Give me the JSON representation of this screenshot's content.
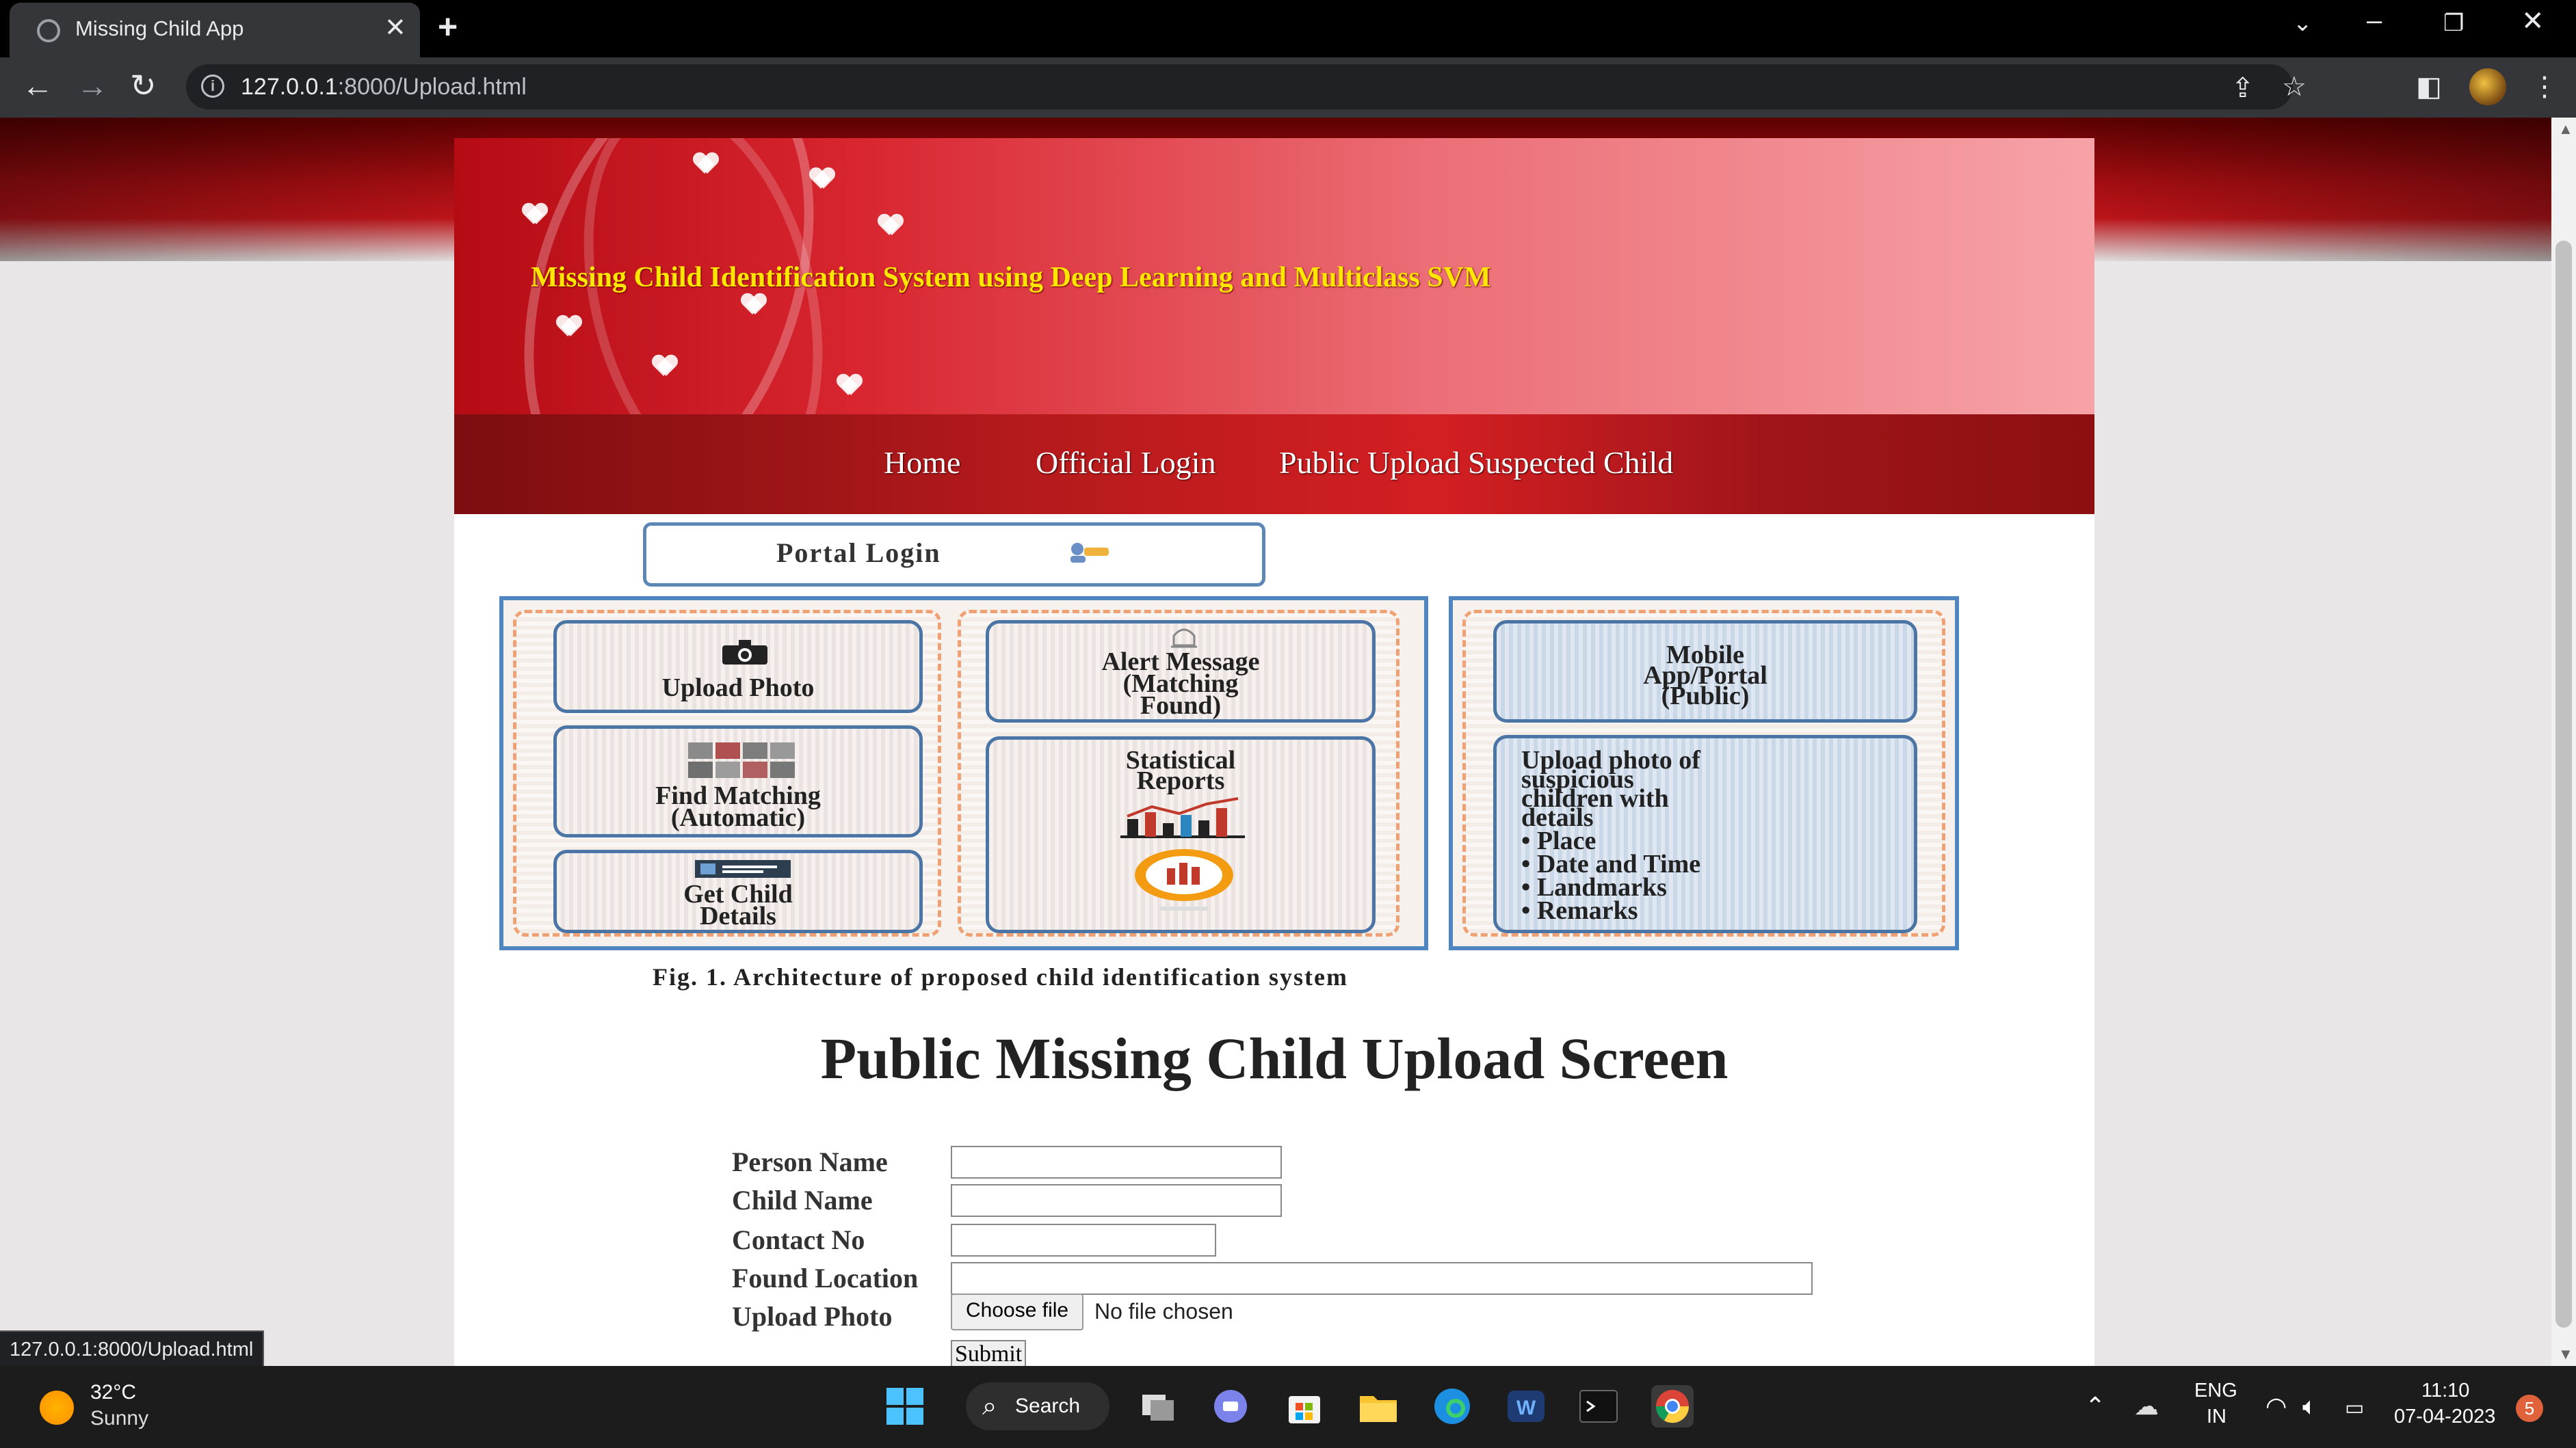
{
  "browser": {
    "tab_title": "Missing Child App",
    "url_host": "127.0.0.1",
    "url_path": ":8000/Upload.html",
    "status_url": "127.0.0.1:8000/Upload.html"
  },
  "header": {
    "title": "Missing Child Identification System using Deep Learning and Multiclass SVM"
  },
  "nav": {
    "items": [
      "Home",
      "Official Login",
      "Public Upload Suspected Child"
    ]
  },
  "figure": {
    "portal_login": "Portal Login",
    "upload_photo": "Upload Photo",
    "find_matching": [
      "Find Matching",
      "(Automatic)"
    ],
    "get_child_details": [
      "Get Child",
      "Details"
    ],
    "alert_message": [
      "Alert Message",
      "(Matching",
      "Found)"
    ],
    "statistical_reports": [
      "Statistical",
      "Reports"
    ],
    "mobile_app": [
      "Mobile",
      "App/Portal",
      "(Public)"
    ],
    "upload_suspicious": [
      "Upload photo of",
      "suspicious",
      "children with",
      "details"
    ],
    "bullets": [
      "Place",
      "Date and Time",
      "Landmarks",
      "Remarks"
    ],
    "caption": "Fig. 1.   Architecture of proposed child identification system"
  },
  "form": {
    "heading": "Public Missing Child Upload Screen",
    "labels": {
      "person_name": "Person Name",
      "child_name": "Child Name",
      "contact_no": "Contact No",
      "found_location": "Found Location",
      "upload_photo": "Upload Photo"
    },
    "values": {
      "person_name": "",
      "child_name": "",
      "contact_no": "",
      "found_location": ""
    },
    "choose_file": "Choose file",
    "file_status": "No file chosen",
    "submit": "Submit"
  },
  "taskbar": {
    "temperature": "32°C",
    "weather": "Sunny",
    "search": "Search",
    "lang1": "ENG",
    "lang2": "IN",
    "time": "11:10",
    "date": "07-04-2023",
    "notifications": "5"
  },
  "colors": {
    "banner_title": "#ffe600",
    "accent_red": "#b51a1c",
    "figure_blue": "#4f86c0"
  }
}
